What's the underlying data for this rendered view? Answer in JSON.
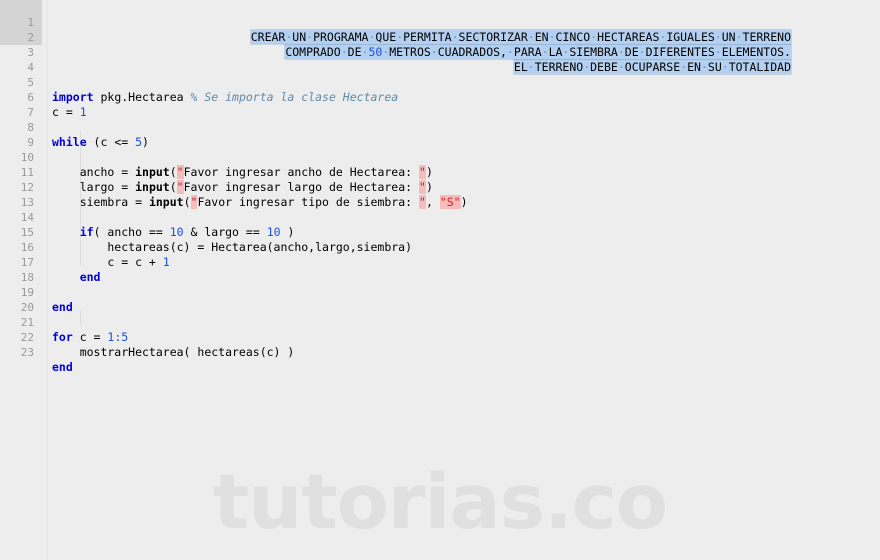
{
  "app": {
    "type": "code-editor",
    "background_color": "#ededed",
    "selection_color": "#b4d0f0",
    "gutter_selection_color": "#d4d4d4",
    "keyword_color": "#0000dd",
    "number_color": "#1a4fe0",
    "comment_color": "#5f8aa8",
    "string_quote_color": "#d02020",
    "string_quote_bg": "#f5bcbc",
    "line_number_color": "#999999"
  },
  "watermark": {
    "text": "tutorias.co",
    "color": "#e0e0e0"
  },
  "gutter": {
    "numbers": [
      "1",
      "2",
      "3",
      "4",
      "5",
      "6",
      "7",
      "8",
      "9",
      "10",
      "11",
      "12",
      "13",
      "14",
      "15",
      "16",
      "17",
      "18",
      "19",
      "20",
      "21",
      "22",
      "23"
    ]
  },
  "header_comment": {
    "selected": true,
    "lines": [
      "CREAR UN PROGRAMA QUE PERMITA SECTORIZAR EN CINCO HECTAREAS IGUALES UN TERRENO",
      "COMPRADO DE 50 METROS CUADRADOS, PARA LA SIEMBRA DE DIFERENTES ELEMENTOS.",
      "EL TERRENO DEBE OCUPARSE EN SU TOTALIDAD"
    ],
    "line1": {
      "a": "CREAR UN PROGRAMA QUE PERMITA SECTORIZAR EN CINCO HECTAREAS IGUALES UN TERRENO"
    },
    "line2": {
      "a": "COMPRADO DE ",
      "num": "50",
      "b": " METROS CUADRADOS, PARA LA SIEMBRA DE DIFERENTES ELEMENTOS."
    },
    "line3": {
      "a": "EL TERRENO DEBE OCUPARSE EN SU TOTALIDAD"
    }
  },
  "code": {
    "line5": {
      "kw": "import",
      "target": " pkg.Hectarea ",
      "comment": "% Se importa la clase Hectarea"
    },
    "line6": {
      "a": "c = ",
      "num": "1"
    },
    "line8": {
      "kw": "while",
      "a": " (c <= ",
      "num": "5",
      "b": ")"
    },
    "line10": {
      "a": "    ancho = ",
      "fn": "input",
      "b": "(",
      "q1": "\"",
      "str": "Favor ingresar ancho de Hectarea: ",
      "q2": "\"",
      "c": ")"
    },
    "line11": {
      "a": "    largo = ",
      "fn": "input",
      "b": "(",
      "q1": "\"",
      "str": "Favor ingresar largo de Hectarea: ",
      "q2": "\"",
      "c": ")"
    },
    "line12": {
      "a": "    siembra = ",
      "fn": "input",
      "b": "(",
      "q1": "\"",
      "str": "Favor ingresar tipo de siembra: ",
      "q2": "\"",
      "c": ", ",
      "s2": "\"S\"",
      "d": ")"
    },
    "line14": {
      "a": "    ",
      "kw": "if",
      "b": "( ancho == ",
      "num1": "10",
      "c": " & largo == ",
      "num2": "10",
      "d": " )"
    },
    "line15": {
      "a": "        hectareas(c) = Hectarea(ancho,largo,siembra)"
    },
    "line16": {
      "a": "        c = c + ",
      "num": "1"
    },
    "line17": {
      "a": "    ",
      "kw": "end"
    },
    "line19": {
      "kw": "end"
    },
    "line21": {
      "kw": "for",
      "a": " c = ",
      "num": "1:5"
    },
    "line22": {
      "a": "    mostrarHectarea( hectareas(c) )"
    },
    "line23": {
      "kw": "end"
    }
  }
}
